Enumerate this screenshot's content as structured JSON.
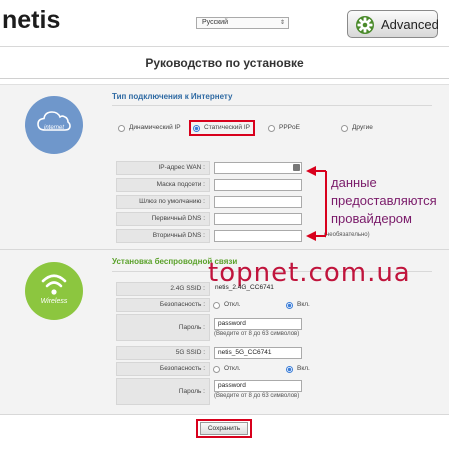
{
  "header": {
    "logo": "netis",
    "language": "Русский",
    "advanced_label": "Advanced"
  },
  "page_title": "Руководство по установке",
  "internet": {
    "badge_label": "internet",
    "section_title": "Тип подключения к Интернету",
    "connection_types": [
      {
        "label": "Динамический IP",
        "selected": false
      },
      {
        "label": "Статический IP",
        "selected": true
      },
      {
        "label": "PPPoE",
        "selected": false
      },
      {
        "label": "Другие",
        "selected": false
      }
    ],
    "fields": [
      {
        "label": "IP-адрес WAN :",
        "value": ""
      },
      {
        "label": "Маска подсети :",
        "value": ""
      },
      {
        "label": "Шлюз по умолчанию :",
        "value": ""
      },
      {
        "label": "Первичный DNS :",
        "value": ""
      },
      {
        "label": "Вторичный DNS :",
        "value": ""
      }
    ],
    "secondary_dns_hint": "(необязательно)"
  },
  "annotation": {
    "lines": [
      "данные",
      "предоставляются",
      "провайдером"
    ],
    "color": "#d8001c"
  },
  "watermark": "topnet.com.ua",
  "wireless": {
    "badge_label": "Wireless",
    "section_title": "Установка беспроводной связи",
    "bands": [
      {
        "ssid_label": "2.4G SSID :",
        "ssid_value": "netis_2.4G_CC6741",
        "security_label": "Безопасность :",
        "off_label": "Откл.",
        "on_label": "Вкл.",
        "security_on": true,
        "password_label": "Пароль :",
        "password_value": "password",
        "password_hint": "(Введите от 8 до 63 символов)"
      },
      {
        "ssid_label": "5G SSID :",
        "ssid_value": "netis_5G_CC6741",
        "security_label": "Безопасность :",
        "off_label": "Откл.",
        "on_label": "Вкл.",
        "security_on": true,
        "password_label": "Пароль :",
        "password_value": "password",
        "password_hint": "(Введите от 8 до 63 символов)"
      }
    ]
  },
  "save_label": "Сохранить",
  "colors": {
    "internet_accent": "#2f6aa3",
    "wireless_accent": "#5aa12a",
    "internet_circle": "#6f97cb",
    "wireless_circle": "#8cc63f"
  }
}
